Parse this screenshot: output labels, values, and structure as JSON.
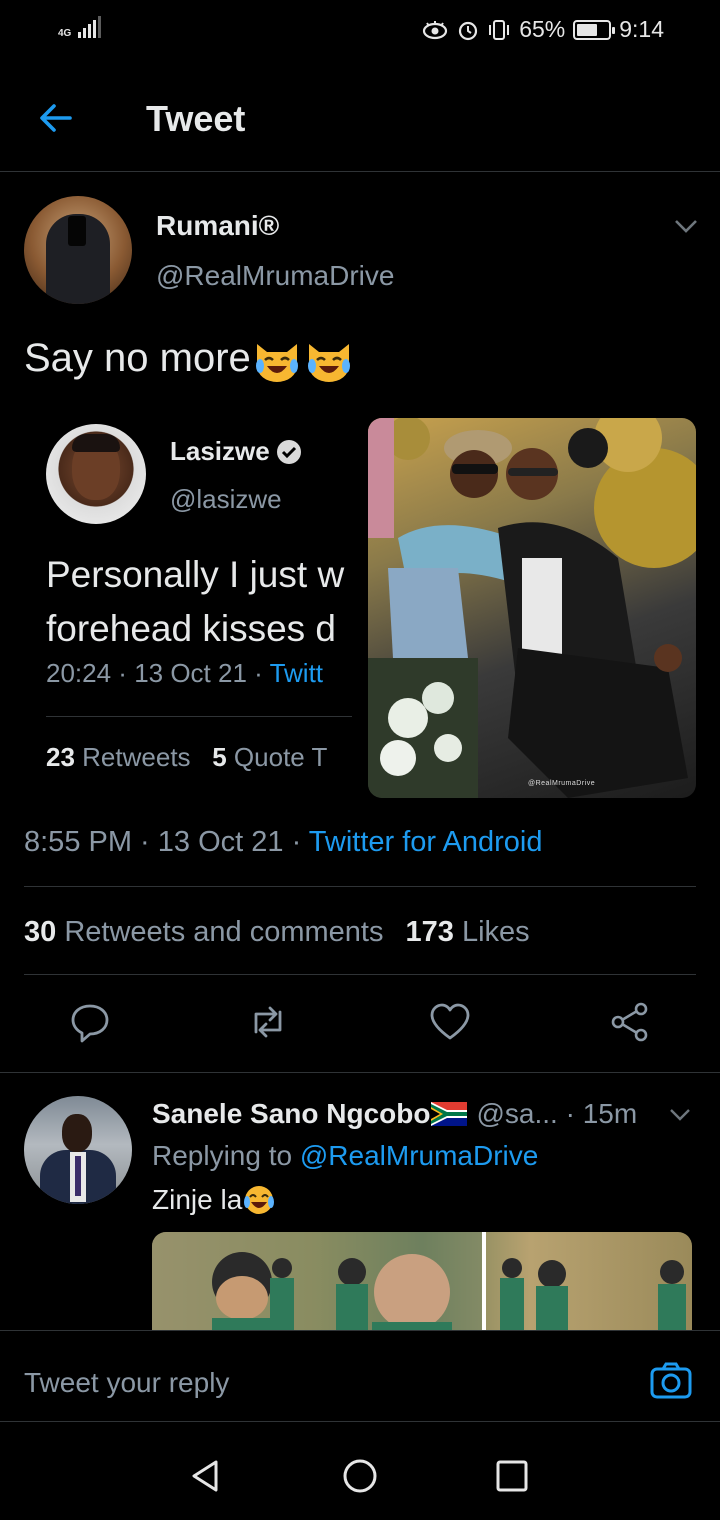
{
  "status_bar": {
    "network": "4G",
    "battery_percent": "65%",
    "time": "9:14"
  },
  "header": {
    "title": "Tweet"
  },
  "tweet": {
    "author_name": "Rumani®",
    "author_handle": "@RealMrumaDrive",
    "text": "Say no more",
    "emoji": [
      "joy-cat-emoji",
      "joy-cat-emoji"
    ],
    "quoted": {
      "author_name": "Lasizwe",
      "author_handle": "@lasizwe",
      "text_lines": [
        "Personally I just w",
        "forehead kisses d"
      ],
      "time": "20:24",
      "date": "13 Oct 21",
      "source": "Twitt",
      "retweets_count": "23",
      "retweets_label": "Retweets",
      "quotes_count": "5",
      "quotes_label": "Quote T",
      "image_watermark": "@RealMrumaDrive"
    },
    "time": "8:55 PM",
    "date": "13 Oct 21",
    "source": "Twitter for Android",
    "retweets_comments_count": "30",
    "retweets_comments_label": "Retweets and comments",
    "likes_count": "173",
    "likes_label": "Likes"
  },
  "reply": {
    "author_name": "Sanele Sano Ngcobo",
    "author_handle": "@sa...",
    "time": "· 15m",
    "replying_prefix": "Replying to",
    "replying_to": "@RealMrumaDrive",
    "text": "Zinje la"
  },
  "composer": {
    "placeholder": "Tweet your reply"
  },
  "colors": {
    "accent": "#1d9bf0",
    "background": "#000000",
    "secondary_text": "#8b98a5",
    "primary_text": "#e7e9ea",
    "divider": "#2f3336"
  }
}
